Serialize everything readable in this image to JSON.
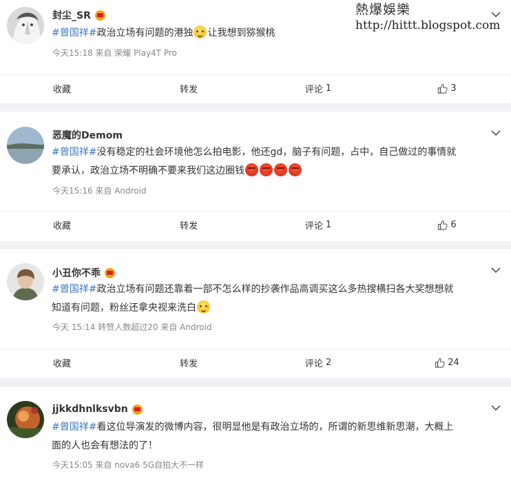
{
  "watermark": {
    "title": "熱爆娛樂",
    "url": "http://hittt.blogspot.com"
  },
  "actions_labels": {
    "favorite": "收藏",
    "forward": "转发",
    "comment_prefix": "评论"
  },
  "posts": [
    {
      "username": "封尘_SR",
      "topic": "#曾国祥#",
      "text_lines": [
        "政治立场有问题的港独",
        "让我想到猕猴桃"
      ],
      "meta": "今天15:18  来自 荣耀 Play4T Pro",
      "comments": "1",
      "likes": "3"
    },
    {
      "username": "恶魔的Demom",
      "topic": "#曾国祥#",
      "text_line1": "没有稳定的社会环境他怎么拍电影，他还gd，脑子有问题，占中，自己做过的事情就",
      "text_line2": "要承认，政治立场不明确不要来我们这边圈钱",
      "meta": "今天15:16  来自 Android",
      "comments": "1",
      "likes": "6"
    },
    {
      "username": "小丑你不乖",
      "topic": "#曾国祥#",
      "text_line1": "政治立场有问题还靠着一部不怎么样的抄袭作品高调买这么多热搜横扫各大奖想想就",
      "text_line2": "知道有问题，粉丝还拿央视来洗白",
      "meta": "今天 15:14 转赞人数超过20  来自 Android",
      "comments": "2",
      "likes": "24"
    },
    {
      "username": "jjkkdhnlksvbn",
      "topic": "#曾国祥#",
      "text_line1": "看这位导演发的微博内容，很明显他是有政治立场的，所谓的新思维新思潮，大概上",
      "text_line2": "面的人也会有想法的了！",
      "meta": "今天15:05  来自 nova6 5G自拍大不一样"
    }
  ],
  "colors": {
    "topic": "#3d7ac2",
    "meta": "#888888",
    "background": "#f2f2f5"
  }
}
